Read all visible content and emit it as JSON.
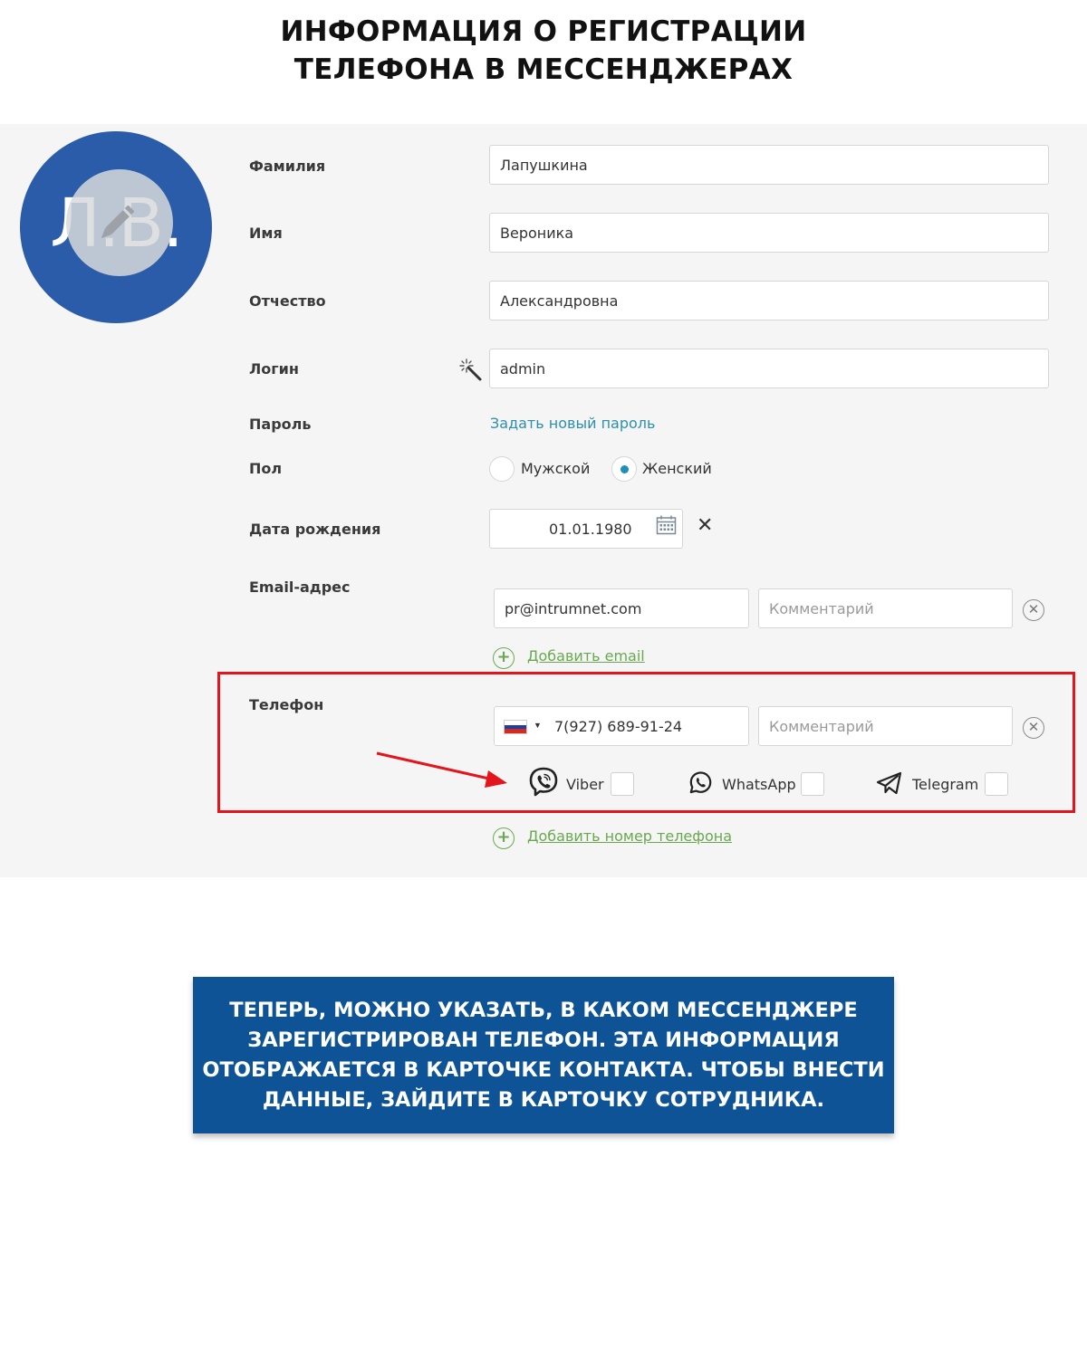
{
  "page": {
    "title_line1": "ИНФОРМАЦИЯ О РЕГИСТРАЦИИ",
    "title_line2": "ТЕЛЕФОНА В МЕССЕНДЖЕРАХ"
  },
  "avatar": {
    "initials": "Л.В.",
    "icon": "pencil-icon",
    "color": "#2a5ca9"
  },
  "form": {
    "surname": {
      "label": "Фамилия",
      "value": "Лапушкина"
    },
    "name": {
      "label": "Имя",
      "value": "Вероника"
    },
    "patronymic": {
      "label": "Отчество",
      "value": "Александровна"
    },
    "login": {
      "label": "Логин",
      "value": "admin",
      "icon": "magic-wand-icon"
    },
    "password": {
      "label": "Пароль",
      "link": "Задать новый пароль"
    },
    "gender": {
      "label": "Пол",
      "options": [
        "Мужской",
        "Женский"
      ],
      "selected": "Женский"
    },
    "birthdate": {
      "label": "Дата рождения",
      "value": "01.01.1980",
      "icon": "calendar-icon",
      "clear": "✕"
    },
    "email": {
      "label": "Email-адрес",
      "value": "pr@intrumnet.com",
      "comment_placeholder": "Комментарий",
      "add_link": "Добавить email"
    },
    "phone": {
      "label": "Телефон",
      "value": "7(927) 689-91-24",
      "comment_placeholder": "Комментарий",
      "messengers": [
        {
          "name": "Viber",
          "icon": "viber-icon",
          "checked": false
        },
        {
          "name": "WhatsApp",
          "icon": "whatsapp-icon",
          "checked": false
        },
        {
          "name": "Telegram",
          "icon": "telegram-icon",
          "checked": false
        }
      ],
      "add_link": "Добавить номер телефона"
    }
  },
  "colors": {
    "highlight": "#e3161d",
    "accent_link": "#2d8fb0",
    "add_green": "#6aa84f",
    "info_bg": "#0d5395"
  },
  "info": {
    "line1": "ТЕПЕРЬ, МОЖНО УКАЗАТЬ, В КАКОМ МЕССЕНДЖЕРЕ",
    "line2": "ЗАРЕГИСТРИРОВАН ТЕЛЕФОН. ЭТА ИНФОРМАЦИЯ",
    "line3": "ОТОБРАЖАЕТСЯ В КАРТОЧКЕ КОНТАКТА. ЧТОБЫ ВНЕСТИ",
    "line4": "ДАННЫЕ, ЗАЙДИТЕ В КАРТОЧКУ СОТРУДНИКА."
  }
}
